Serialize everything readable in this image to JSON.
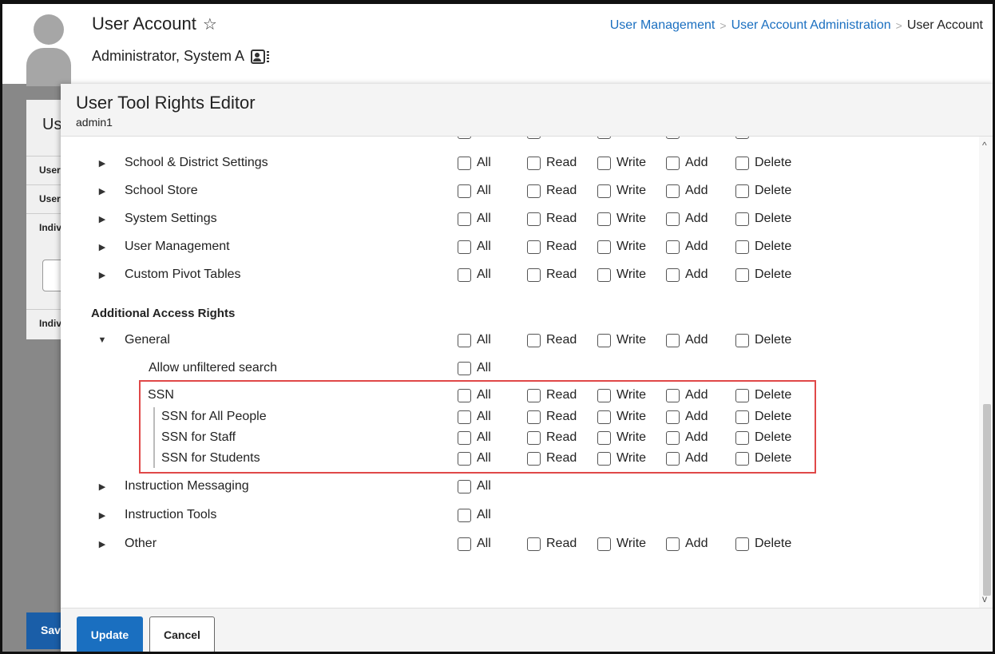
{
  "header": {
    "title": "User Account",
    "user_name": "Administrator, System A"
  },
  "breadcrumb": {
    "items": [
      "User Management",
      "User Account Administration"
    ],
    "current": "User Account"
  },
  "background": {
    "card_title": "Us",
    "rows": [
      "User",
      "User",
      "Indiv",
      "Indiv"
    ],
    "save_label": "Sav"
  },
  "modal": {
    "title": "User Tool Rights Editor",
    "subtitle": "admin1",
    "scroll_up_icon": "chevron-up-icon",
    "scroll_down_icon": "chevron-down-icon"
  },
  "rights_labels": {
    "all": "All",
    "read": "Read",
    "write": "Write",
    "add": "Add",
    "delete": "Delete"
  },
  "tool_rows": [
    {
      "label": "School & District Settings",
      "expanded": false
    },
    {
      "label": "School Store",
      "expanded": false
    },
    {
      "label": "System Settings",
      "expanded": false
    },
    {
      "label": "User Management",
      "expanded": false
    },
    {
      "label": "Custom Pivot Tables",
      "expanded": false
    }
  ],
  "section": {
    "title": "Additional Access Rights"
  },
  "general": {
    "label": "General",
    "expanded": true,
    "allow_unfiltered": "Allow unfiltered search",
    "ssn": {
      "label": "SSN",
      "children": [
        "SSN for All People",
        "SSN for Staff",
        "SSN for Students"
      ]
    }
  },
  "more_rows": [
    {
      "label": "Instruction Messaging",
      "all_only": true
    },
    {
      "label": "Instruction Tools",
      "all_only": true
    },
    {
      "label": "Other",
      "all_only": false
    }
  ],
  "footer": {
    "update_label": "Update",
    "cancel_label": "Cancel"
  },
  "colors": {
    "accent": "#1a6fc0",
    "highlight": "#e04848"
  }
}
